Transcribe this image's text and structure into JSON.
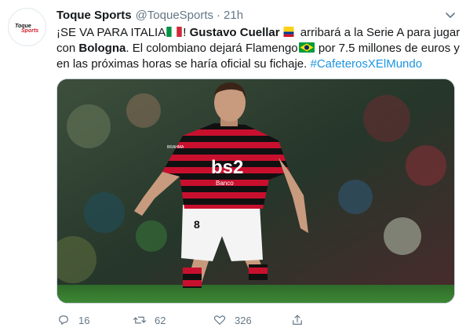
{
  "tweet": {
    "author_name": "Toque Sports",
    "author_handle": "@ToqueSports",
    "separator": "·",
    "time": "21h",
    "avatar_text": "Toque Sports",
    "text": {
      "l1_a": "¡SE VA PARA ITALIA",
      "l1_b": "! ",
      "l1_name": "Gustavo Cuellar",
      "l1_c": " arribará a la Serie A para jugar",
      "l2_a": "con ",
      "l2_team": "Bologna",
      "l2_b": ". El colombiano dejará Flamengo",
      "l2_c": " por 7.5 millones de euros y",
      "l3_a": "en las próximas horas se haría oficial su fichaje. ",
      "l3_hashtag": "#CafeterosXElMundo"
    },
    "flags": [
      "flag-italy",
      "flag-colombia",
      "flag-brazil"
    ]
  },
  "media": {
    "jersey_sponsor": "bs2",
    "jersey_sub": "Banco",
    "shorts_number": "8",
    "sleeve_text": "BRAHMA"
  },
  "actions": {
    "reply_count": "16",
    "retweet_count": "62",
    "like_count": "326"
  },
  "colors": {
    "accent": "#1b95e0",
    "muted": "#657786",
    "text": "#14171a"
  }
}
